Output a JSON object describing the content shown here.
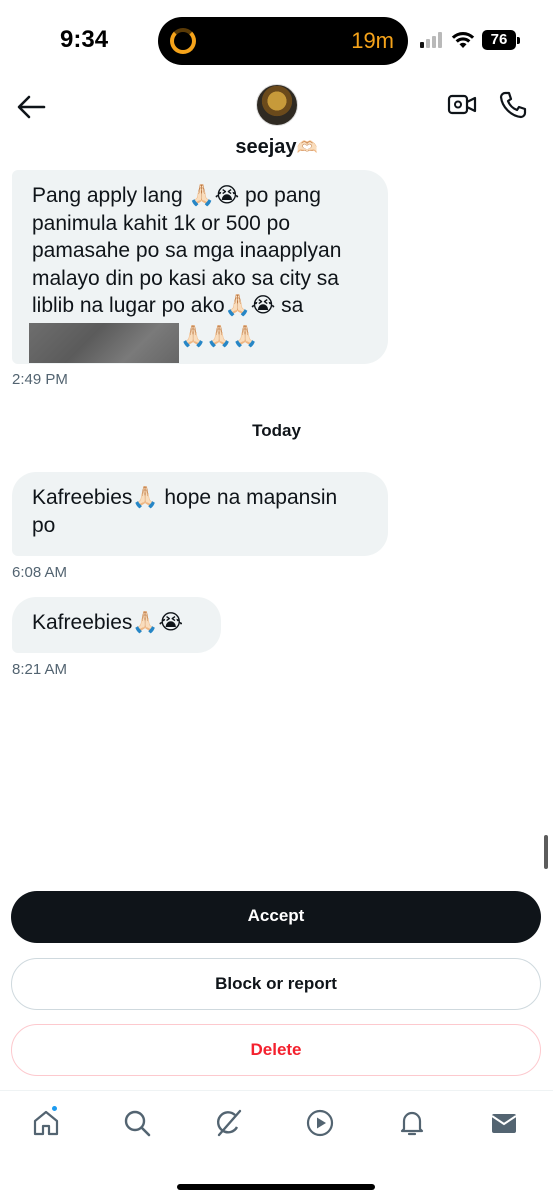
{
  "status_bar": {
    "time": "9:34",
    "activity": "19m",
    "battery": "76"
  },
  "header": {
    "contact_name": "seejay",
    "name_emoji": "🫶🏻",
    "back_icon": "arrow-left-icon",
    "video_icon": "video-camera-icon",
    "call_icon": "phone-icon"
  },
  "messages": [
    {
      "lines": [
        "Pang apply lang 🙏🏻😭  po pang",
        "panimula  kahit 1k or 500 po",
        "pamasahe po sa mga inaapplyan",
        "malayo din po kasi ako sa city sa",
        "liblib na lugar po ako🙏🏻😭  sa"
      ],
      "trailing": "🙏🏻🙏🏻🙏🏻",
      "time": "2:49 PM"
    },
    {
      "lines": [
        "Kafreebies🙏🏻 hope na mapansin",
        "po"
      ],
      "time": "6:08 AM"
    },
    {
      "lines": [
        "Kafreebies🙏🏻😭"
      ],
      "time": "8:21 AM"
    }
  ],
  "date_separator": "Today",
  "actions": {
    "accept": "Accept",
    "block_report": "Block or report",
    "delete": "Delete"
  },
  "tabbar": [
    "home-icon",
    "search-icon",
    "grok-icon",
    "video-play-icon",
    "notifications-bell-icon",
    "messages-envelope-icon"
  ],
  "colors": {
    "bubble": "#eff3f4",
    "accept_bg": "#0f1419",
    "delete_text": "#f4212e",
    "notification_dot": "#1d9bf0",
    "timer": "#f5a31a"
  }
}
